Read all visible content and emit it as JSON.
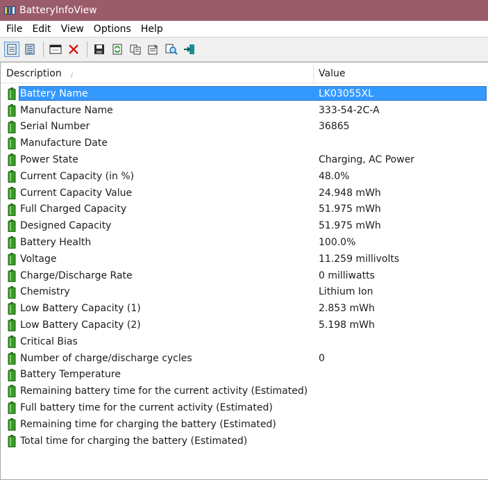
{
  "window": {
    "title": "BatteryInfoView"
  },
  "menu": [
    "File",
    "Edit",
    "View",
    "Options",
    "Help"
  ],
  "toolbar": {
    "icons": [
      "html-report-icon",
      "properties-list-icon",
      "window-icon",
      "delete-icon",
      "save-icon",
      "refresh-icon",
      "copy-icon",
      "properties-icon",
      "find-icon",
      "exit-icon"
    ]
  },
  "table": {
    "columns": [
      "Description",
      "Value"
    ],
    "rows": [
      {
        "description": "Battery Name",
        "value": "LK03055XL",
        "selected": true
      },
      {
        "description": "Manufacture Name",
        "value": "333-54-2C-A"
      },
      {
        "description": "Serial Number",
        "value": "36865"
      },
      {
        "description": "Manufacture Date",
        "value": ""
      },
      {
        "description": "Power State",
        "value": "Charging, AC Power"
      },
      {
        "description": "Current Capacity (in %)",
        "value": "48.0%"
      },
      {
        "description": "Current Capacity Value",
        "value": "24.948 mWh"
      },
      {
        "description": "Full Charged Capacity",
        "value": "51.975 mWh"
      },
      {
        "description": "Designed Capacity",
        "value": "51.975 mWh"
      },
      {
        "description": "Battery Health",
        "value": "100.0%"
      },
      {
        "description": "Voltage",
        "value": "11.259 millivolts"
      },
      {
        "description": "Charge/Discharge Rate",
        "value": "0 milliwatts"
      },
      {
        "description": "Chemistry",
        "value": "Lithium Ion"
      },
      {
        "description": "Low Battery Capacity (1)",
        "value": "2.853 mWh"
      },
      {
        "description": "Low Battery Capacity (2)",
        "value": "5.198 mWh"
      },
      {
        "description": "Critical Bias",
        "value": ""
      },
      {
        "description": "Number of charge/discharge cycles",
        "value": "0"
      },
      {
        "description": "Battery Temperature",
        "value": ""
      },
      {
        "description": "Remaining battery time for the current activity (Estimated)",
        "value": ""
      },
      {
        "description": "Full battery time for the current activity (Estimated)",
        "value": ""
      },
      {
        "description": "Remaining time for charging the battery (Estimated)",
        "value": ""
      },
      {
        "description": "Total  time for charging the battery (Estimated)",
        "value": ""
      }
    ]
  },
  "colors": {
    "titlebar": "#9a5c6a",
    "selection": "#3399ff",
    "battery_green": "#3a9a2a"
  }
}
